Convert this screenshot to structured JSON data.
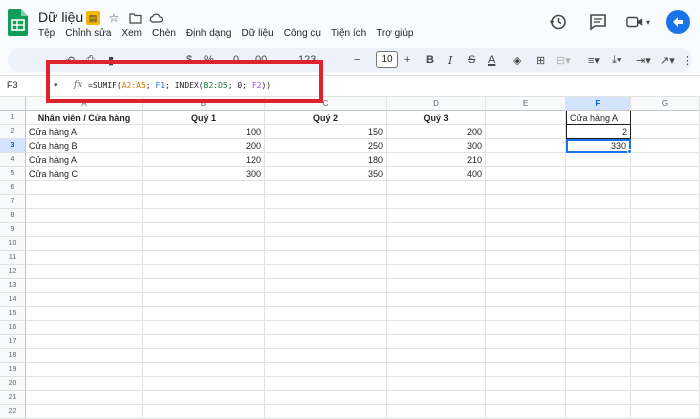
{
  "app": {
    "doc_title": "Dữ liệu"
  },
  "menu": [
    "Tệp",
    "Chỉnh sửa",
    "Xem",
    "Chèn",
    "Định dạng",
    "Dữ liệu",
    "Công cụ",
    "Tiện ích",
    "Trợ giúp"
  ],
  "toolbar": {
    "font_size": "10"
  },
  "formula_bar": {
    "name_box": "F3",
    "fx": "fx",
    "formula_parts": [
      "=SUMIF(",
      "A2:A5",
      "; ",
      "F1",
      "; INDEX(",
      "B2:D5",
      "; 0; ",
      "F2",
      "))"
    ]
  },
  "columns": [
    "A",
    "B",
    "C",
    "D",
    "E",
    "F",
    "G"
  ],
  "rows": [
    "1",
    "2",
    "3",
    "4",
    "5",
    "6",
    "7",
    "8",
    "9",
    "10",
    "11",
    "12",
    "13",
    "14",
    "15",
    "16",
    "17",
    "18",
    "19",
    "20",
    "21",
    "22"
  ],
  "sheet": {
    "header": [
      "Nhân viên / Cửa hàng",
      "Quý 1",
      "Quý 2",
      "Quý 3"
    ],
    "data": [
      [
        "Cửa hàng A",
        "100",
        "150",
        "200"
      ],
      [
        "Cửa hàng B",
        "200",
        "250",
        "300"
      ],
      [
        "Cửa hàng A",
        "120",
        "180",
        "210"
      ],
      [
        "Cửa hàng C",
        "300",
        "350",
        "400"
      ]
    ],
    "f1": "Cửa hàng A",
    "f2": "2",
    "f3": "330"
  }
}
